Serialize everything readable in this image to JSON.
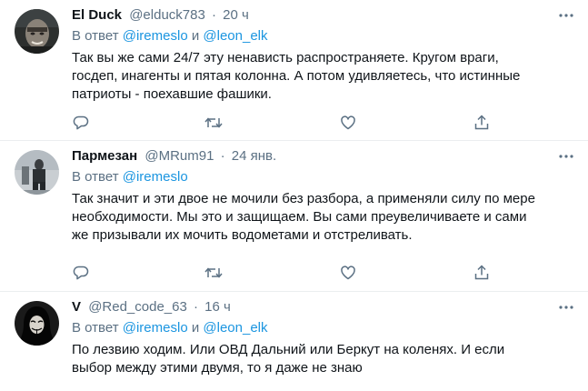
{
  "tweets": [
    {
      "name": "El Duck",
      "handle": "@elduck783",
      "separator": "·",
      "time": "20 ч",
      "reply_prefix": "В ответ",
      "mentions": [
        "@iremeslo",
        "@leon_elk"
      ],
      "reply_joiner": "и",
      "text_lines": [
        "Так вы же сами 24/7 эту ненависть распространяете. Кругом враги,",
        "госдеп, инагенты и пятая колонна. А потом удивляетесь, что истинные",
        "патриоты - поехавшие фашики."
      ]
    },
    {
      "name": "Пармезан",
      "handle": "@MRum91",
      "separator": "·",
      "time": "24 янв.",
      "reply_prefix": "В ответ",
      "mentions": [
        "@iremeslo"
      ],
      "text_lines": [
        "Так значит и эти двое не мочили без разбора, а применяли силу по мере",
        "необходимости. Мы это и защищаем. Вы сами преувеличиваете и сами",
        "же призывали их мочить водометами и отстреливать."
      ]
    },
    {
      "name": "V",
      "handle": "@Red_code_63",
      "separator": "·",
      "time": "16 ч",
      "reply_prefix": "В ответ",
      "mentions": [
        "@iremeslo",
        "@leon_elk"
      ],
      "reply_joiner": "и",
      "text_lines": [
        "По лезвию ходим. Или ОВД Дальний или Беркут на коленях. И если",
        "выбор между этими двумя, то я даже не знаю"
      ]
    }
  ],
  "icons": {
    "more": "more-icon",
    "reply": "reply-icon",
    "retweet": "retweet-icon",
    "like": "like-icon",
    "share": "share-icon"
  },
  "colors": {
    "text": "#0f1419",
    "secondary": "#5b7083",
    "link": "#1b95e0",
    "divider": "#ebeef0"
  }
}
